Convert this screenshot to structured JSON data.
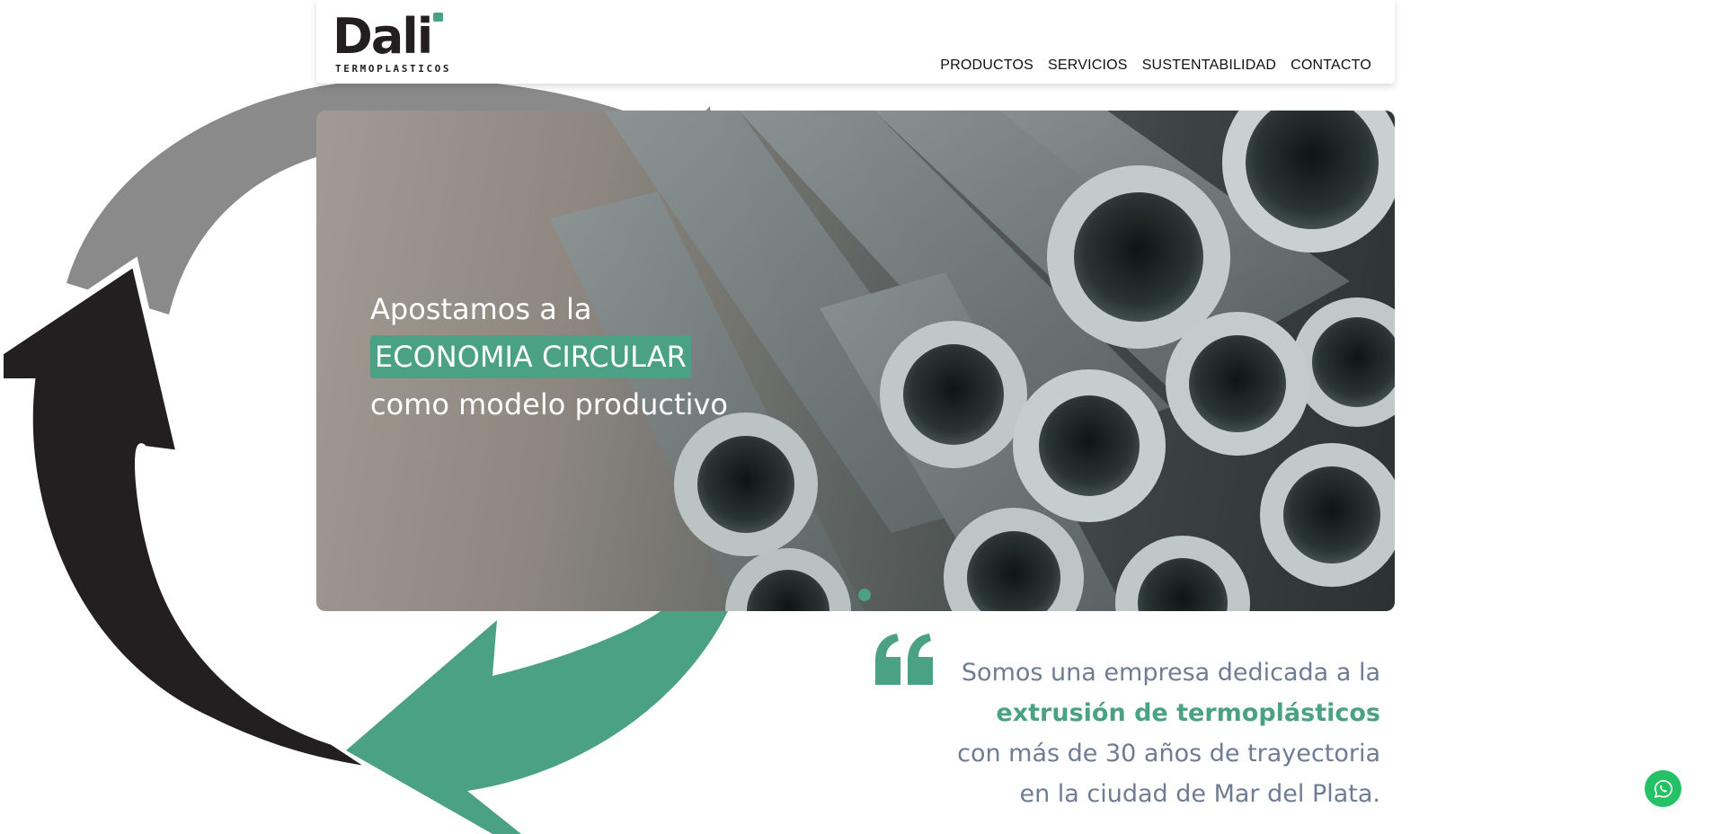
{
  "brand": {
    "name": "Dali",
    "tagline": "TERMOPLASTICOS"
  },
  "nav": {
    "items": [
      "PRODUCTOS",
      "SERVICIOS",
      "SUSTENTABILIDAD",
      "CONTACTO"
    ]
  },
  "hero": {
    "line1": "Apostamos a la",
    "highlight": "ECONOMIA CIRCULAR",
    "line3": "como modelo productivo",
    "active_slide": 1,
    "slide_count": 1
  },
  "about": {
    "part1": "Somos una empresa dedicada a la",
    "emphasis": "extrusión de termoplásticos",
    "part2": "con más de 30 años de trayectoria en la ciudad de Mar del Plata."
  },
  "icons": {
    "quote": "quote-icon",
    "whatsapp": "whatsapp-icon",
    "recycle": "recycle-arrows-icon"
  },
  "colors": {
    "accent": "#4aa183",
    "dark": "#231f20",
    "gray": "#8a8a8a",
    "text_muted": "#707c93",
    "whatsapp": "#25c166"
  }
}
